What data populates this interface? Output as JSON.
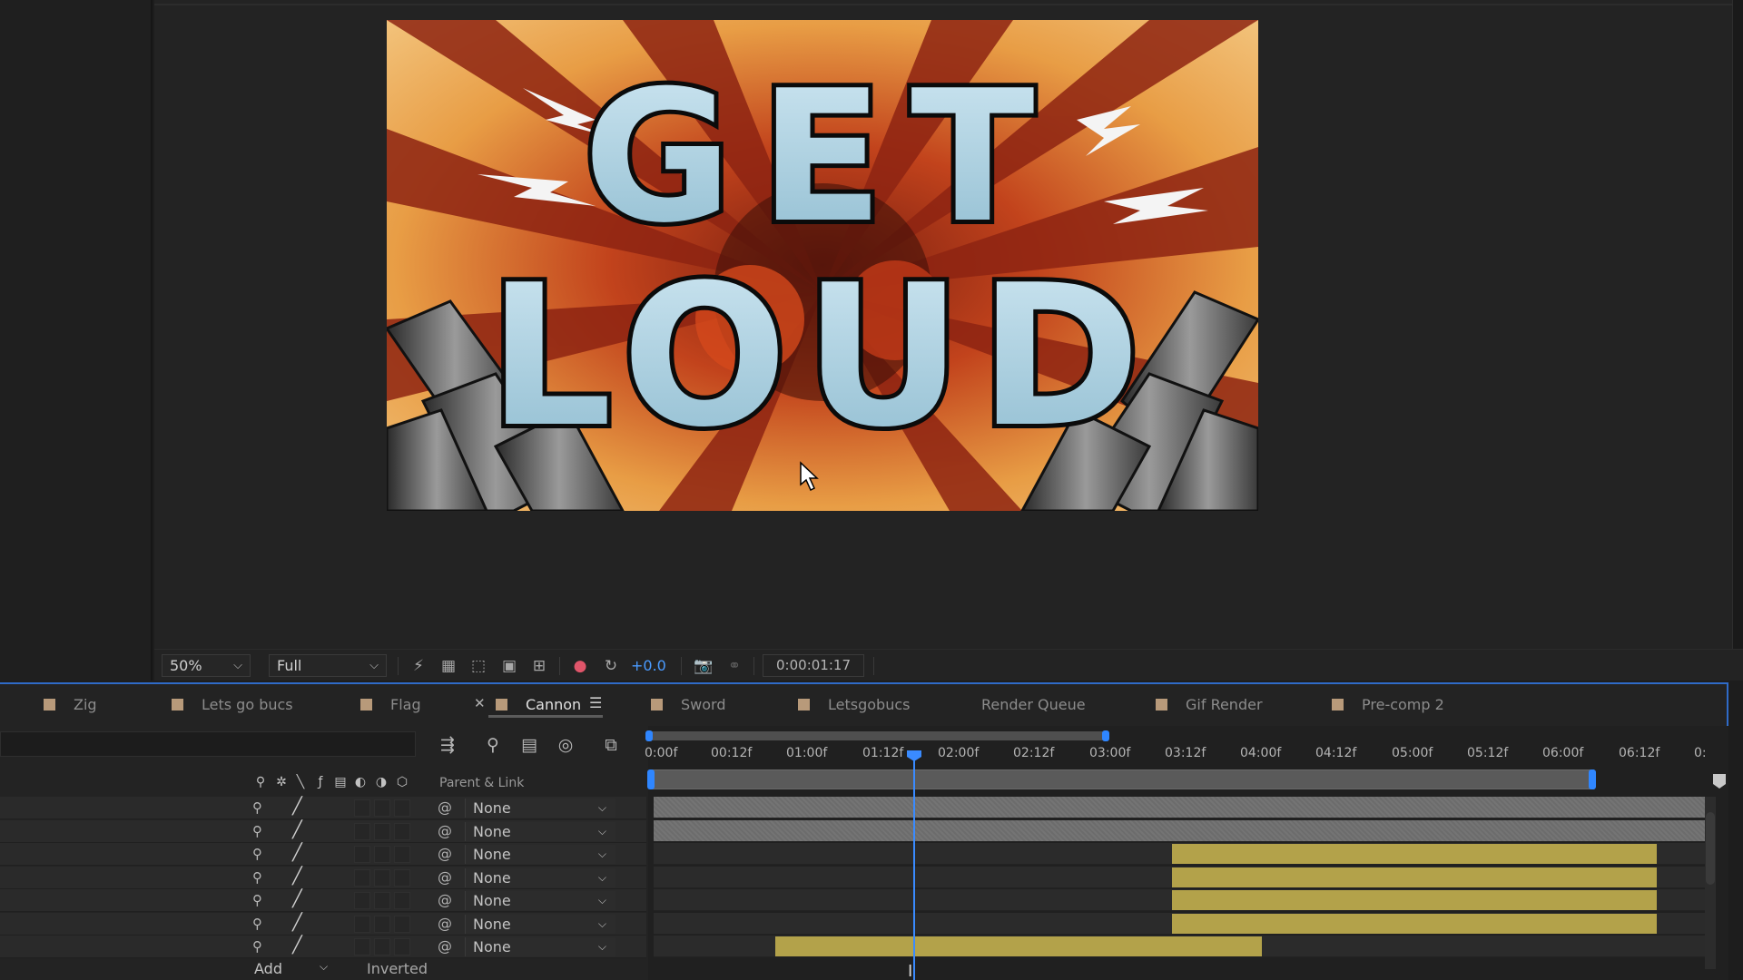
{
  "viewer": {
    "artwork_text_line1": "GET",
    "artwork_text_line2": "LOUD",
    "toolbar": {
      "zoom": "50%",
      "resolution": "Full",
      "exposure": "+0.0",
      "timecode": "0:00:01:17"
    }
  },
  "timeline": {
    "tabs": [
      {
        "label": "Zig",
        "color": "#b89a7a"
      },
      {
        "label": "Lets go bucs",
        "color": "#b89a7a"
      },
      {
        "label": "Flag",
        "color": "#b89a7a"
      },
      {
        "label": "Cannon",
        "color": "#b89a7a",
        "active": true
      },
      {
        "label": "Sword",
        "color": "#b89a7a"
      },
      {
        "label": "Letsgobucs",
        "color": "#b89a7a"
      },
      {
        "label": "Render Queue"
      },
      {
        "label": "Gif Render",
        "color": "#b89a7a"
      },
      {
        "label": "Pre-comp 2",
        "color": "#b89a7a"
      }
    ],
    "parent_link_header": "Parent & Link",
    "layers": [
      {
        "parent": "None"
      },
      {
        "parent": "None"
      },
      {
        "parent": "None"
      },
      {
        "parent": "None"
      },
      {
        "parent": "None"
      },
      {
        "parent": "None"
      },
      {
        "parent": "None"
      }
    ],
    "mask_mode": "Add",
    "inverted_label": "Inverted",
    "ruler": [
      "0:00f",
      "00:12f",
      "01:00f",
      "01:12f",
      "02:00f",
      "02:12f",
      "03:00f",
      "03:12f",
      "04:00f",
      "04:12f",
      "05:00f",
      "05:12f",
      "06:00f",
      "06:12f",
      "0:"
    ],
    "current_time": "0:00:01:17",
    "accent_color": "#2f86ff",
    "clip_color": "#b3a24a"
  }
}
